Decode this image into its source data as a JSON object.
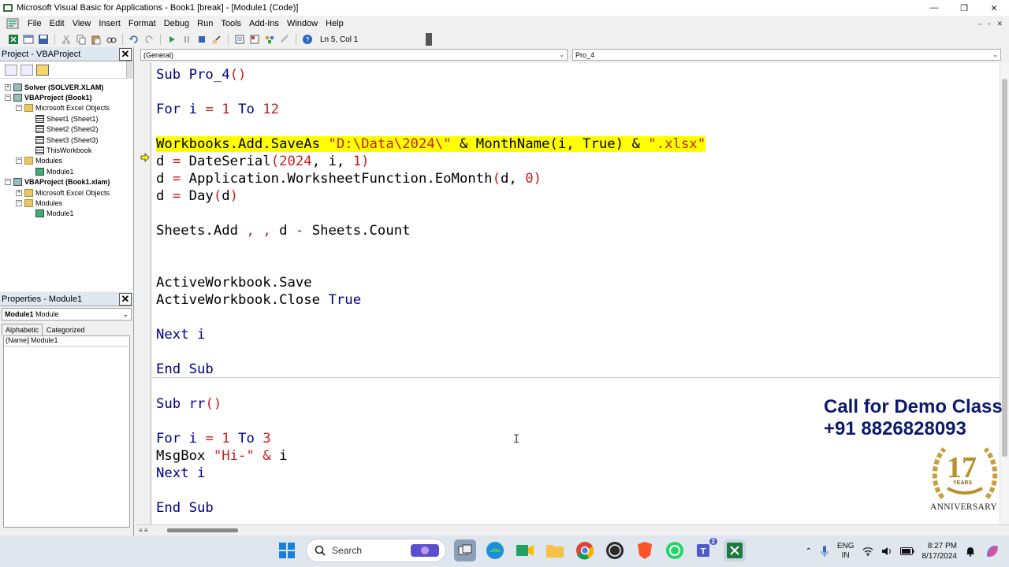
{
  "window": {
    "title": "Microsoft Visual Basic for Applications - Book1 [break] - [Module1 (Code)]",
    "minimize": "—",
    "maximize": "❐",
    "close": "✕"
  },
  "menu": {
    "items": [
      "File",
      "Edit",
      "View",
      "Insert",
      "Format",
      "Debug",
      "Run",
      "Tools",
      "Add-Ins",
      "Window",
      "Help"
    ],
    "mdi": [
      "–",
      "▫",
      "✕"
    ]
  },
  "toolbar": {
    "position": "Ln 5, Col 1"
  },
  "project_panel": {
    "title": "Project - VBAProject",
    "close": "✕",
    "tree": [
      {
        "label": "Solver (SOLVER.XLAM)",
        "level": 0,
        "icon": "project-icon",
        "bold": true,
        "expander": "+"
      },
      {
        "label": "VBAProject (Book1)",
        "level": 0,
        "icon": "project-icon",
        "bold": true,
        "expander": "−"
      },
      {
        "label": "Microsoft Excel Objects",
        "level": 1,
        "icon": "folder-icon",
        "bold": false,
        "expander": "−"
      },
      {
        "label": "Sheet1 (Sheet1)",
        "level": 2,
        "icon": "sheet-icon",
        "bold": false,
        "expander": ""
      },
      {
        "label": "Sheet2 (Sheet2)",
        "level": 2,
        "icon": "sheet-icon",
        "bold": false,
        "expander": ""
      },
      {
        "label": "Sheet3 (Sheet3)",
        "level": 2,
        "icon": "sheet-icon",
        "bold": false,
        "expander": ""
      },
      {
        "label": "ThisWorkbook",
        "level": 2,
        "icon": "workbook-icon",
        "bold": false,
        "expander": ""
      },
      {
        "label": "Modules",
        "level": 1,
        "icon": "folder-icon",
        "bold": false,
        "expander": "−"
      },
      {
        "label": "Module1",
        "level": 2,
        "icon": "module-icon",
        "bold": false,
        "expander": ""
      },
      {
        "label": "VBAProject (Book1.xlam)",
        "level": 0,
        "icon": "project-icon",
        "bold": true,
        "expander": "−"
      },
      {
        "label": "Microsoft Excel Objects",
        "level": 1,
        "icon": "folder-icon",
        "bold": false,
        "expander": "+"
      },
      {
        "label": "Modules",
        "level": 1,
        "icon": "folder-icon",
        "bold": false,
        "expander": "−"
      },
      {
        "label": "Module1",
        "level": 2,
        "icon": "module-icon",
        "bold": false,
        "expander": ""
      }
    ]
  },
  "properties_panel": {
    "title": "Properties - Module1",
    "close": "✕",
    "object_name": "Module1",
    "object_type": "Module",
    "tabs": [
      "Alphabetic",
      "Categorized"
    ],
    "rows": [
      {
        "name": "(Name)",
        "value": "Module1"
      }
    ]
  },
  "code_window": {
    "object_combo": "(General)",
    "procedure_combo": "Pro_4",
    "lines": [
      [
        {
          "t": "Sub Pro_4",
          "c": "kw"
        },
        {
          "t": "()",
          "c": "op"
        }
      ],
      [],
      [
        {
          "t": "For i ",
          "c": "kw"
        },
        {
          "t": "=",
          "c": "op"
        },
        {
          "t": " ",
          "c": ""
        },
        {
          "t": "1",
          "c": "num"
        },
        {
          "t": " To ",
          "c": "kw"
        },
        {
          "t": "12",
          "c": "num"
        }
      ],
      [],
      [
        {
          "t": "Workbooks.Add.SaveAs ",
          "c": "hl"
        },
        {
          "t": "\"D:\\Data\\2024\\\"",
          "c": "hl str"
        },
        {
          "t": " & MonthName(i, True) & ",
          "c": "hl"
        },
        {
          "t": "\".xlsx\"",
          "c": "hl str"
        }
      ],
      [
        {
          "t": "d ",
          "c": ""
        },
        {
          "t": "=",
          "c": "op"
        },
        {
          "t": " DateSerial",
          "c": ""
        },
        {
          "t": "(2024",
          "c": "num"
        },
        {
          "t": ", i, ",
          "c": ""
        },
        {
          "t": "1)",
          "c": "num"
        }
      ],
      [
        {
          "t": "d ",
          "c": ""
        },
        {
          "t": "=",
          "c": "op"
        },
        {
          "t": " Application.WorksheetFunction.EoMonth",
          "c": ""
        },
        {
          "t": "(",
          "c": "op"
        },
        {
          "t": "d, ",
          "c": ""
        },
        {
          "t": "0)",
          "c": "num"
        }
      ],
      [
        {
          "t": "d ",
          "c": ""
        },
        {
          "t": "=",
          "c": "op"
        },
        {
          "t": " Day",
          "c": ""
        },
        {
          "t": "(",
          "c": "op"
        },
        {
          "t": "d",
          "c": ""
        },
        {
          "t": ")",
          "c": "op"
        }
      ],
      [],
      [
        {
          "t": "Sheets.Add ",
          "c": ""
        },
        {
          "t": ", ,",
          "c": "op"
        },
        {
          "t": " d ",
          "c": ""
        },
        {
          "t": "-",
          "c": "op"
        },
        {
          "t": " Sheets.Count",
          "c": ""
        }
      ],
      [],
      [],
      [
        {
          "t": "ActiveWorkbook.Save",
          "c": ""
        }
      ],
      [
        {
          "t": "ActiveWorkbook.Close ",
          "c": ""
        },
        {
          "t": "True",
          "c": "kw"
        }
      ],
      [],
      [
        {
          "t": "Next i",
          "c": "kw"
        }
      ],
      [],
      [
        {
          "t": "End Sub",
          "c": "kw"
        }
      ],
      [],
      [
        {
          "t": "Sub rr",
          "c": "kw"
        },
        {
          "t": "()",
          "c": "op"
        }
      ],
      [],
      [
        {
          "t": "For i ",
          "c": "kw"
        },
        {
          "t": "=",
          "c": "op"
        },
        {
          "t": " ",
          "c": ""
        },
        {
          "t": "1",
          "c": "num"
        },
        {
          "t": " To ",
          "c": "kw"
        },
        {
          "t": "3",
          "c": "num"
        }
      ],
      [
        {
          "t": "MsgBox ",
          "c": ""
        },
        {
          "t": "\"Hi-\"",
          "c": "str"
        },
        {
          "t": " ",
          "c": ""
        },
        {
          "t": "&",
          "c": "op"
        },
        {
          "t": " i",
          "c": ""
        }
      ],
      [
        {
          "t": "Next i",
          "c": "kw"
        }
      ],
      [],
      [
        {
          "t": "End Sub",
          "c": "kw"
        }
      ]
    ]
  },
  "overlay": {
    "line1": "Call for Demo Class",
    "line2": "+91 8826828093",
    "badge_number": "17",
    "badge_years": "YEARS",
    "badge_text": "ANNIVERSARY"
  },
  "taskbar": {
    "search_placeholder": "Search",
    "lang_line1": "ENG",
    "lang_line2": "IN",
    "time": "8:27 PM",
    "date": "8/17/2024",
    "teams_badge": "2"
  },
  "colors": {
    "keyword": "#00008b",
    "operator": "#c81e1e",
    "highlight": "#ffff00",
    "overlay_text": "#0c1a6b"
  }
}
